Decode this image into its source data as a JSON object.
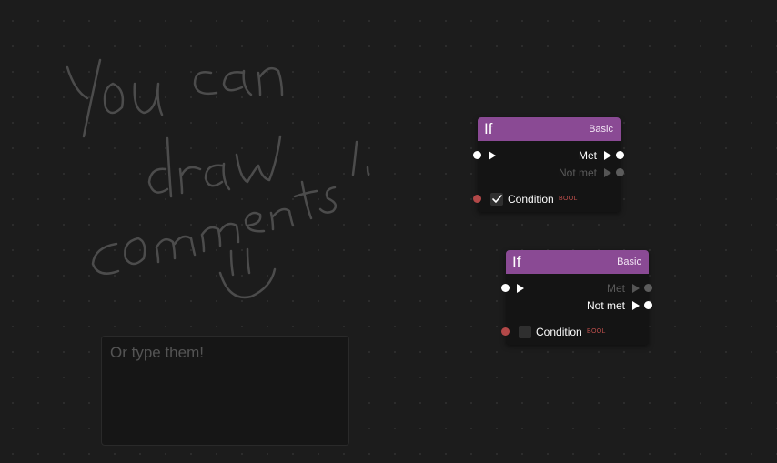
{
  "comment": {
    "placeholder": "Or type them!"
  },
  "nodes": [
    {
      "title": "If",
      "category": "Basic",
      "outputs": {
        "met": "Met",
        "not_met": "Not met"
      },
      "condition": {
        "label": "Condition",
        "type": "BOOL",
        "checked": true
      }
    },
    {
      "title": "If",
      "category": "Basic",
      "outputs": {
        "met": "Met",
        "not_met": "Not met"
      },
      "condition": {
        "label": "Condition",
        "type": "BOOL",
        "checked": false
      }
    }
  ],
  "colors": {
    "header": "#8a4a94",
    "bool_pin": "#b24848",
    "canvas": "#1c1c1c"
  },
  "drawing": {
    "handwritten_text": "You can draw comments!"
  }
}
